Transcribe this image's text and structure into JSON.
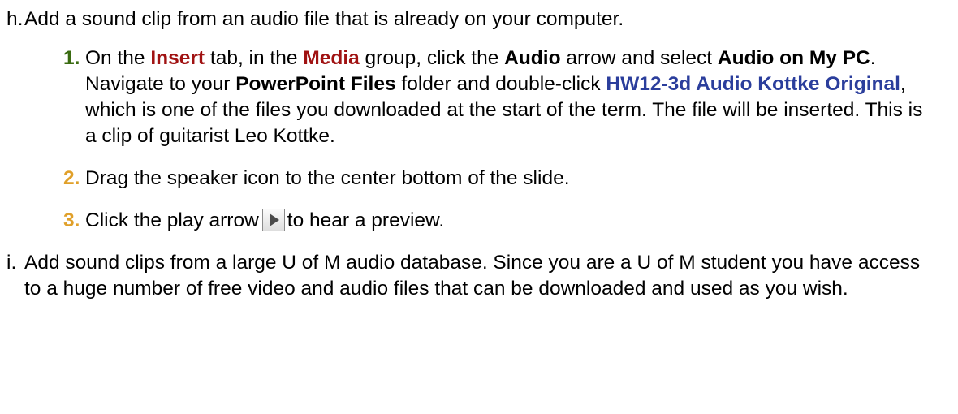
{
  "item_h": {
    "marker": "h.",
    "text": "Add a sound clip from an audio file that is already on your computer."
  },
  "steps": [
    {
      "num": "1.",
      "t1": "On the ",
      "insert_tab": "Insert",
      "t2": " tab, in the ",
      "media_group": "Media",
      "t3": " group, click the ",
      "audio": "Audio",
      "t4": " arrow and select ",
      "audio_on_pc": "Audio on My PC",
      "t5": ". Navigate to your ",
      "folder": "PowerPoint Files",
      "t6": " folder and double-click ",
      "file": "HW12-3d Audio Kottke Original",
      "t7": ", which is one of the files you downloaded at the start of the term. The file will be inserted. This is a clip of guitarist Leo Kottke."
    },
    {
      "num": "2.",
      "text": "Drag the speaker icon to the center bottom of the slide."
    },
    {
      "num": "3.",
      "t1": "Click the play arrow",
      "play_icon": "play-arrow-icon",
      "t2": "to hear a preview."
    }
  ],
  "item_i": {
    "marker": "i.",
    "text": "Add sound clips from a large U of M audio database. Since you are a U of M student you have access to a huge number of free video and audio files that can be downloaded and used as you wish."
  },
  "colors": {
    "step1_number": "#3a6b11",
    "step_number": "#e0a02a",
    "ui_tab_name": "#a01212",
    "file_name": "#2b3e9c"
  }
}
